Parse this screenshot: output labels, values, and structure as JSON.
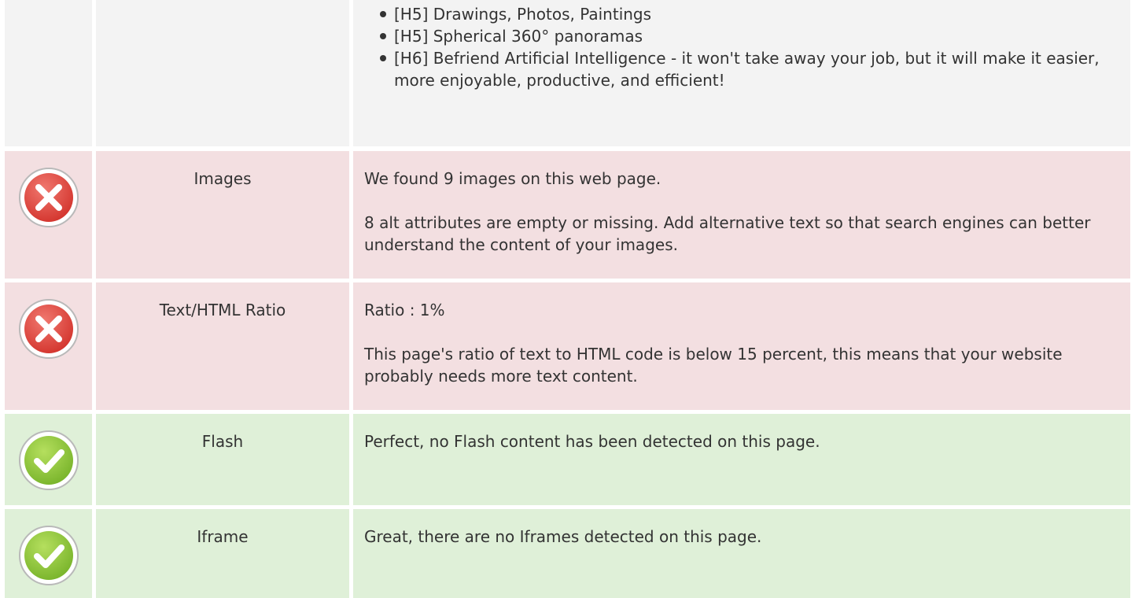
{
  "headings_row": {
    "items": [
      "[H5] Drawings, Photos, Paintings",
      "[H5] Spherical 360° panoramas",
      "[H6] Befriend Artificial Intelligence - it won't take away your job, but it will make it easier, more enjoyable, productive, and efficient!"
    ]
  },
  "rows": [
    {
      "status": "error",
      "icon": "error-x-icon",
      "label": "Images",
      "line1": "We found 9 images on this web page.",
      "line2": "8 alt attributes are empty or missing. Add alternative text so that search engines can better understand the content of your images."
    },
    {
      "status": "error",
      "icon": "error-x-icon",
      "label": "Text/HTML Ratio",
      "line1": "Ratio : 1%",
      "line2": "This page's ratio of text to HTML code is below 15 percent, this means that your website probably needs more text content."
    },
    {
      "status": "ok",
      "icon": "check-icon",
      "label": "Flash",
      "line1": "Perfect, no Flash content has been detected on this page."
    },
    {
      "status": "ok",
      "icon": "check-icon",
      "label": "Iframe",
      "line1": "Great, there are no Iframes detected on this page."
    }
  ],
  "colors": {
    "error_bg": "#f3dfe1",
    "ok_bg": "#dff0d8",
    "neutral_bg": "#f3f3f3",
    "error_icon": "#e0413b",
    "ok_icon": "#8cc63f"
  }
}
